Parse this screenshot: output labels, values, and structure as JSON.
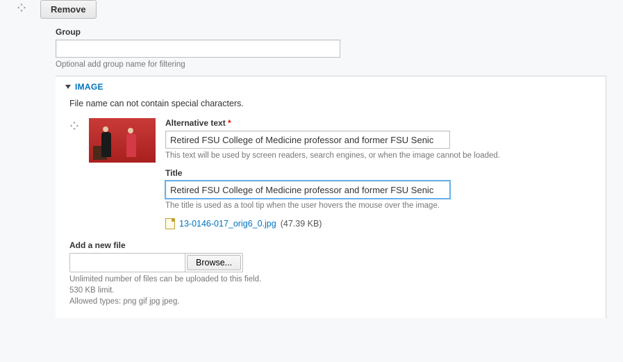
{
  "toolbar": {
    "remove_label": "Remove"
  },
  "group": {
    "label": "Group",
    "value": "",
    "help": "Optional add group name for filtering"
  },
  "image_fieldset": {
    "legend": "IMAGE",
    "note": "File name can not contain special characters.",
    "alt_text": {
      "label": "Alternative text",
      "required_marker": "*",
      "value": "Retired FSU College of Medicine professor and former FSU Senic",
      "help": "This text will be used by screen readers, search engines, or when the image cannot be loaded."
    },
    "title": {
      "label": "Title",
      "value": "Retired FSU College of Medicine professor and former FSU Senic",
      "help": "The title is used as a tool tip when the user hovers the mouse over the image."
    },
    "file": {
      "name": "13-0146-017_orig6_0.jpg",
      "size": "(47.39 KB)"
    },
    "add_file": {
      "label": "Add a new file",
      "browse_label": "Browse...",
      "path_value": "",
      "help1": "Unlimited number of files can be uploaded to this field.",
      "help2": "530 KB limit.",
      "help3": "Allowed types: png gif jpg jpeg."
    }
  }
}
